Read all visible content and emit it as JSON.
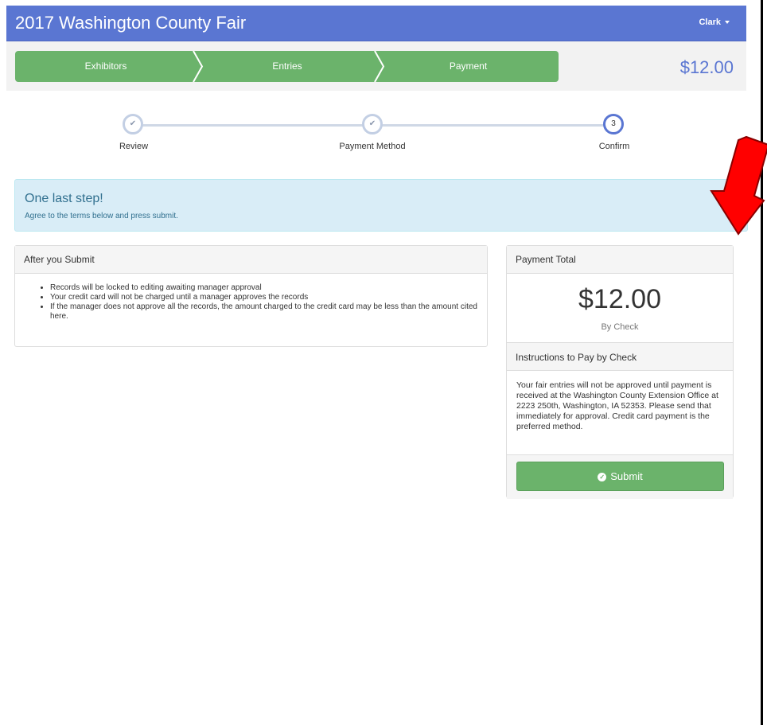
{
  "app": {
    "title": "2017 Washington County Fair",
    "user": "Clark"
  },
  "wizard": {
    "steps": [
      "Exhibitors",
      "Entries",
      "Payment"
    ],
    "total": "$12.00"
  },
  "progress": {
    "steps": [
      {
        "label": "Review",
        "mark": "✔",
        "state": "done"
      },
      {
        "label": "Payment Method",
        "mark": "✔",
        "state": "done"
      },
      {
        "label": "Confirm",
        "mark": "3",
        "state": "current"
      }
    ]
  },
  "alert": {
    "title": "One last step!",
    "text": "Agree to the terms below and press submit."
  },
  "after_submit": {
    "heading": "After you Submit",
    "items": [
      "Records will be locked to editing awaiting manager approval",
      "Your credit card will not be charged until a manager approves the records",
      "If the manager does not approve all the records, the amount charged to the credit card may be less than the amount cited here."
    ]
  },
  "payment": {
    "heading": "Payment Total",
    "amount": "$12.00",
    "method": "By Check",
    "instructions_heading": "Instructions to Pay by Check",
    "instructions": "Your fair entries will not be approved until payment is received at the Washington County Extension Office at 2223 250th, Washington, IA 52353. Please send that immediately for approval. Credit card payment is the preferred method.",
    "submit_label": "Submit"
  },
  "colors": {
    "navbar": "#5a76d2",
    "success": "#6bb36b",
    "info_bg": "#d9edf7",
    "arrow": "#ff0000"
  },
  "icons": {
    "user_menu": "caret-down-icon",
    "done_step": "check-icon",
    "submit": "check-circle-icon",
    "annotation": "red-arrow-icon"
  }
}
